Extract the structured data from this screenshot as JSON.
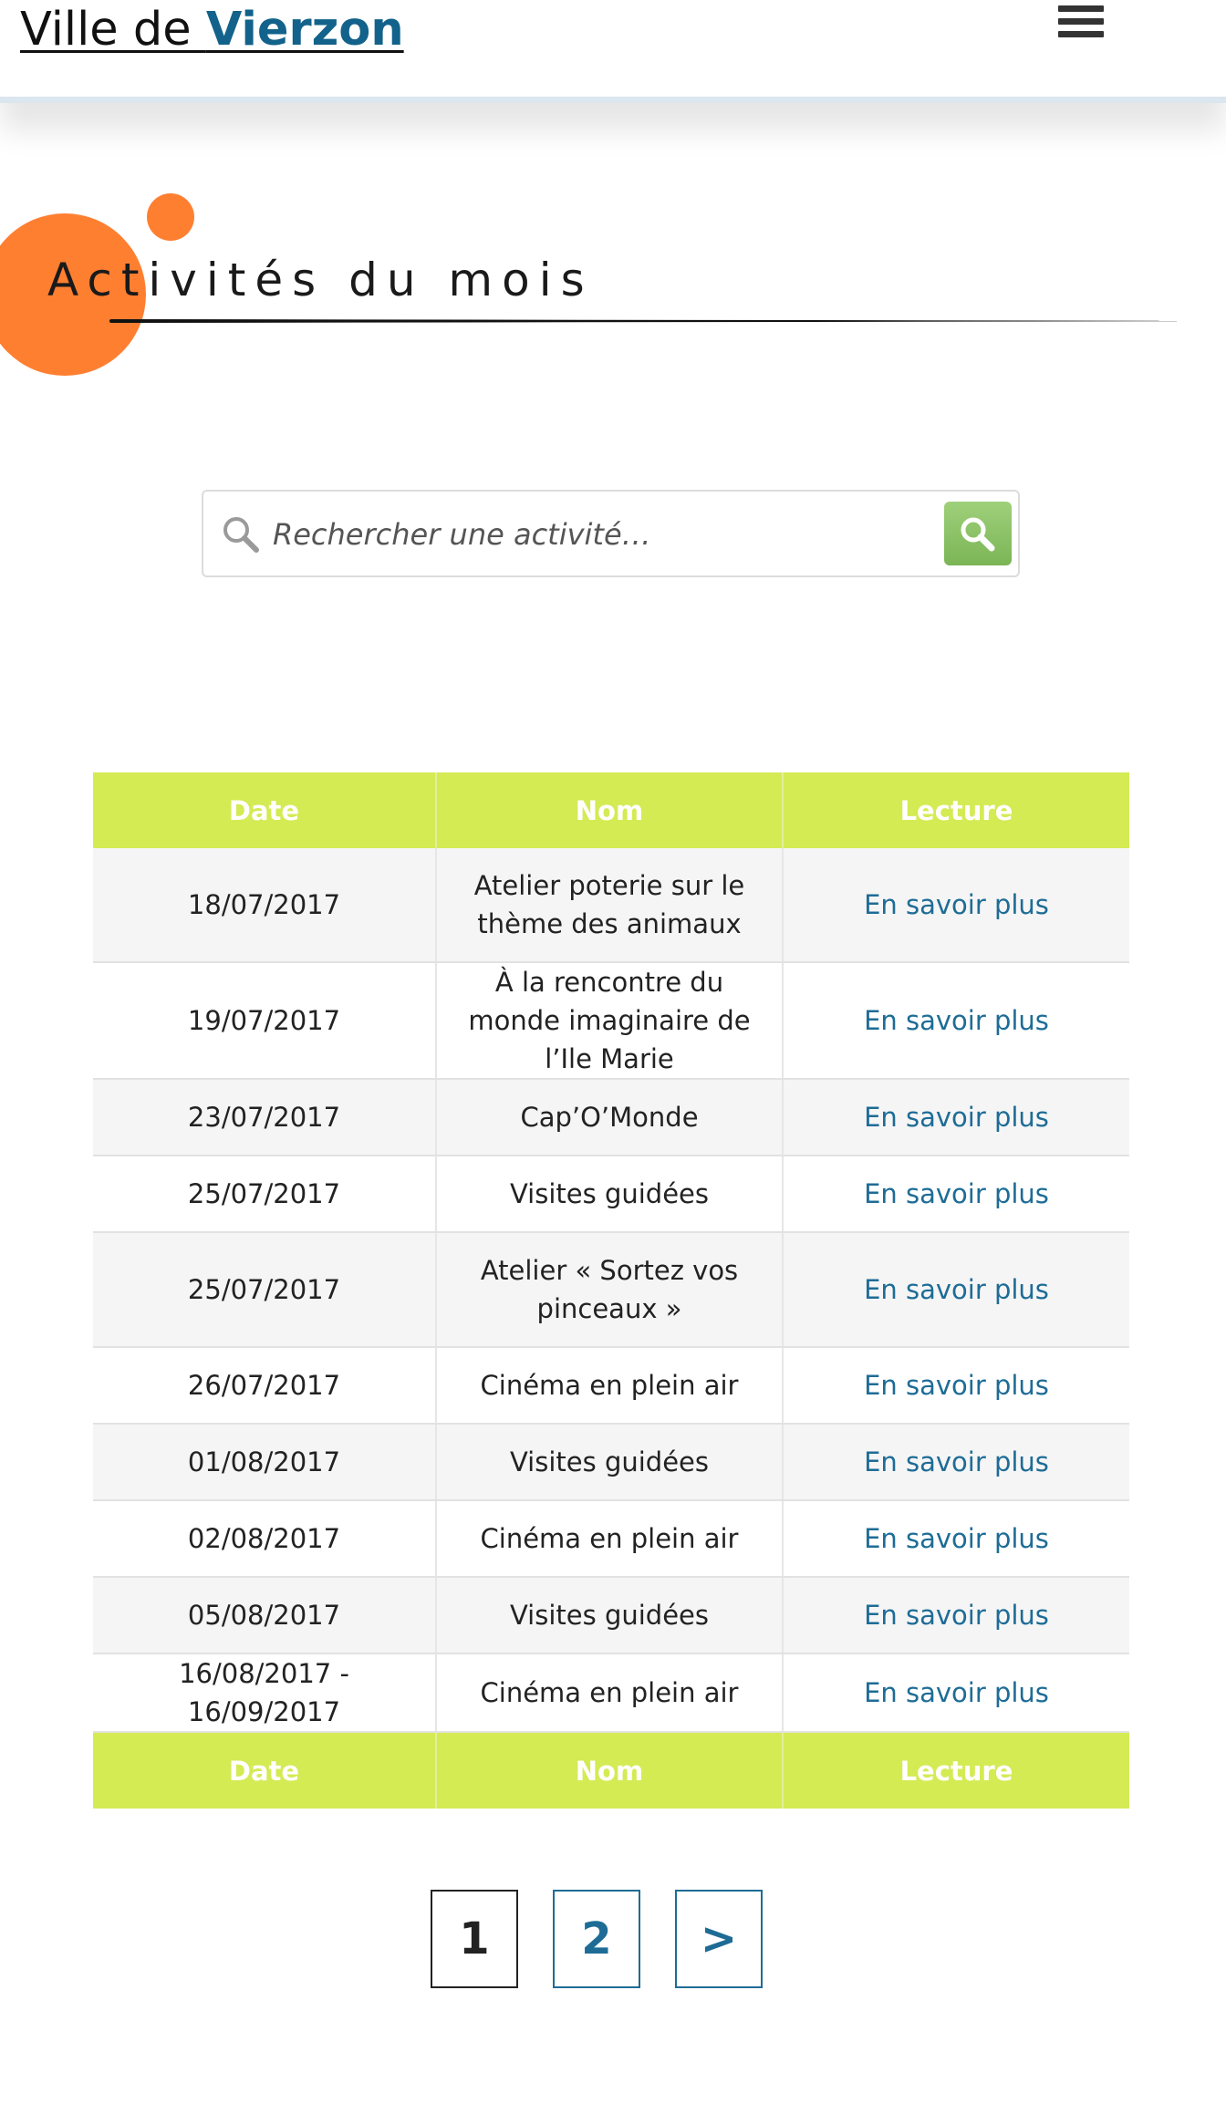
{
  "header": {
    "logo_prefix": "Ville de ",
    "logo_strong": "Vierzon",
    "menu_icon": "hamburger-menu-icon"
  },
  "page": {
    "title": "Activités du mois"
  },
  "search": {
    "placeholder": "Rechercher une activité…",
    "value": "",
    "icon": "search-icon",
    "button_icon": "search-icon"
  },
  "table": {
    "headers": [
      "Date",
      "Nom",
      "Lecture"
    ],
    "footer_headers": [
      "Date",
      "Nom",
      "Lecture"
    ],
    "rows": [
      {
        "date": "18/07/2017",
        "name": "Atelier poterie sur le thème des animaux",
        "link": "En savoir plus"
      },
      {
        "date": "19/07/2017",
        "name": "À la rencontre du monde imaginaire de l’Ile Marie",
        "link": "En savoir plus"
      },
      {
        "date": "23/07/2017",
        "name": "Cap’O’Monde",
        "link": "En savoir plus"
      },
      {
        "date": "25/07/2017",
        "name": "Visites guidées",
        "link": "En savoir plus"
      },
      {
        "date": "25/07/2017",
        "name": "Atelier « Sortez vos pinceaux »",
        "link": "En savoir plus"
      },
      {
        "date": "26/07/2017",
        "name": "Cinéma en plein air",
        "link": "En savoir plus"
      },
      {
        "date": "01/08/2017",
        "name": "Visites guidées",
        "link": "En savoir plus"
      },
      {
        "date": "02/08/2017",
        "name": "Cinéma en plein air",
        "link": "En savoir plus"
      },
      {
        "date": "05/08/2017",
        "name": "Visites guidées",
        "link": "En savoir plus"
      },
      {
        "date": "16/08/2017 - 16/09/2017",
        "name": "Cinéma en plein air",
        "link": "En savoir plus"
      }
    ]
  },
  "pagination": {
    "current": "1",
    "page2": "2",
    "next": ">"
  },
  "colors": {
    "accent_orange": "#ff7f31",
    "brand_blue": "#12628b",
    "table_header_green": "#d4eb54",
    "search_button_green": "#8cc466",
    "link_blue": "#1e6c96"
  }
}
